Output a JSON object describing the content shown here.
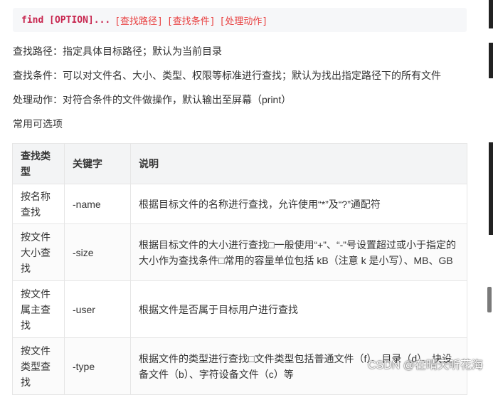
{
  "code": {
    "command": "find",
    "option": "[OPTION]...",
    "args": [
      "[查找路径]",
      "[查找条件]",
      "[处理动作]"
    ]
  },
  "paragraphs": [
    "查找路径：指定具体目标路径；默认为当前目录",
    "查找条件：可以对文件名、大小、类型、权限等标准进行查找；默认为找出指定路径下的所有文件",
    "处理动作：对符合条件的文件做操作，默认输出至屏幕（print）",
    "常用可选项"
  ],
  "table": {
    "headers": [
      "查找类型",
      "关键字",
      "说明"
    ],
    "rows": [
      [
        "按名称查找",
        "-name",
        "根据目标文件的名称进行查找，允许使用“*”及“?”通配符"
      ],
      [
        "按文件大小查找",
        "-size",
        "根据目标文件的大小进行查找□一般使用“+”、“-”号设置超过或小于指定的大小作为查找条件□常用的容量单位包括 kB（注意 k 是小写）、MB、GB"
      ],
      [
        "按文件属主查找",
        "-user",
        "根据文件是否属于目标用户进行查找"
      ],
      [
        "按文件类型查找",
        "-type",
        "根据文件的类型进行查找□文件类型包括普通文件（f）、目录（d）、块设备文件（b）、字符设备文件（c）等"
      ]
    ]
  },
  "watermark": "CSDN @在晴天听花海"
}
